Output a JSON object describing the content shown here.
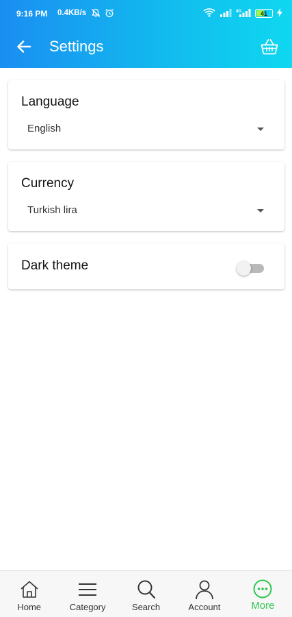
{
  "status": {
    "time": "9:16 PM",
    "speed": "0.4KB/s",
    "battery": "41",
    "icons": [
      "mute-icon",
      "alarm-icon",
      "wifi-icon",
      "signal-icon",
      "signal-icon",
      "battery-icon",
      "charging-icon"
    ]
  },
  "toolbar": {
    "title": "Settings",
    "back_icon": "back-arrow-icon",
    "basket_icon": "basket-icon"
  },
  "settings": {
    "language": {
      "label": "Language",
      "value": "English"
    },
    "currency": {
      "label": "Currency",
      "value": "Turkish lira"
    },
    "dark_theme": {
      "label": "Dark theme",
      "enabled": false
    }
  },
  "nav": {
    "items": [
      {
        "label": "Home",
        "icon": "home-icon",
        "active": false
      },
      {
        "label": "Category",
        "icon": "menu-icon",
        "active": false
      },
      {
        "label": "Search",
        "icon": "search-icon",
        "active": false
      },
      {
        "label": "Account",
        "icon": "person-icon",
        "active": false
      },
      {
        "label": "More",
        "icon": "more-icon",
        "active": true
      }
    ]
  },
  "colors": {
    "header_start": "#1a8ef2",
    "header_end": "#0fd8f0",
    "active_nav": "#2fc64c"
  }
}
